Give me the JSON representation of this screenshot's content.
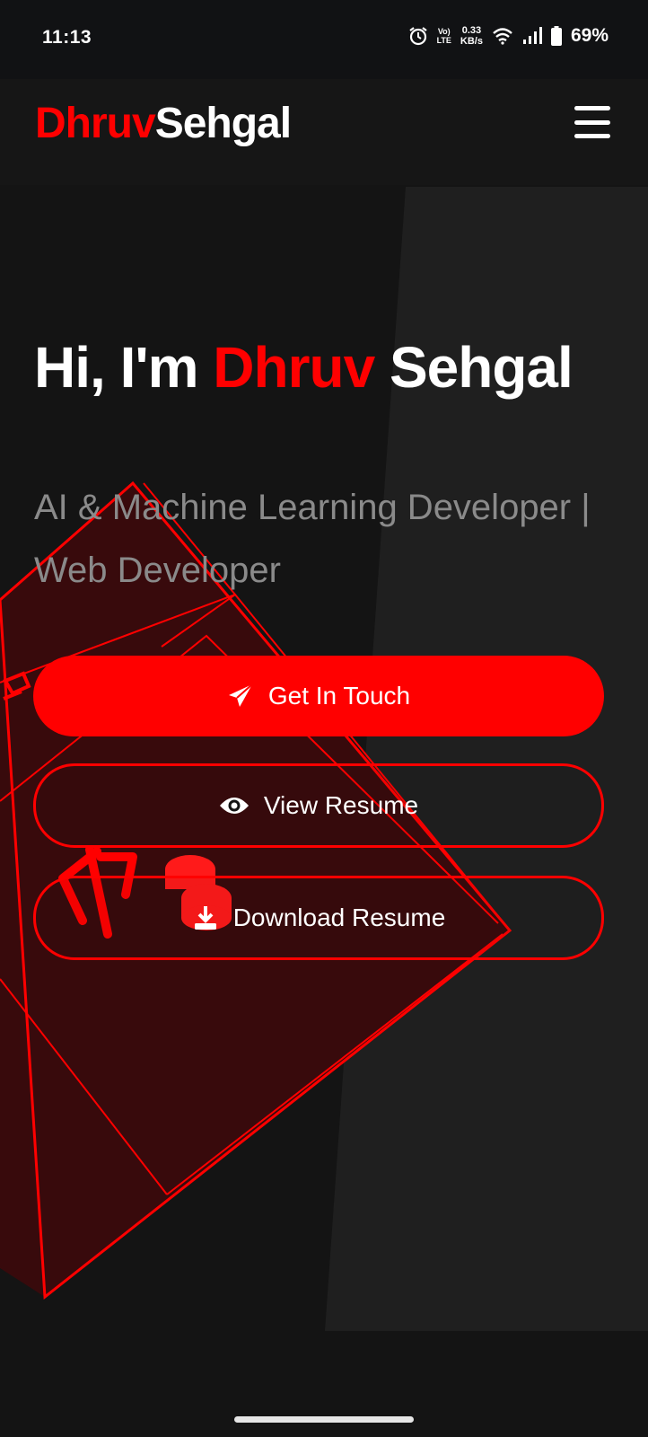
{
  "status_bar": {
    "time": "11:13",
    "volte_top": "Vo)",
    "volte_bottom": "LTE",
    "speed_value": "0.33",
    "speed_unit": "KB/s",
    "battery_percent": "69%",
    "icons": [
      "alarm-icon",
      "volte-icon",
      "wifi-icon",
      "signal-icon",
      "battery-icon"
    ]
  },
  "header": {
    "logo_first": "Dhruv",
    "logo_last": "Sehgal",
    "menu_icon": "hamburger-menu-icon"
  },
  "hero": {
    "greeting": "Hi, I'm ",
    "first_name": "Dhruv",
    "last_name": " Sehgal",
    "subtitle": "AI & Machine Learning Developer | Web Developer"
  },
  "buttons": {
    "contact": {
      "label": "Get In Touch",
      "icon": "paper-plane-icon"
    },
    "view_resume": {
      "label": "View Resume",
      "icon": "eye-icon"
    },
    "download_resume": {
      "label": "Download Resume",
      "icon": "download-icon"
    }
  },
  "colors": {
    "accent": "#ff0000",
    "background": "#141414",
    "panel": "#1f1f1f",
    "subtitle": "#8a8a8a"
  }
}
